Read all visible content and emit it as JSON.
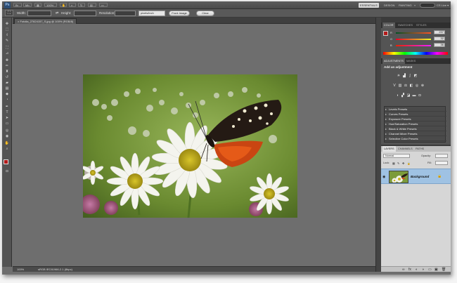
{
  "app": {
    "logo": "Ps",
    "zoom": "100%",
    "view_menu": "▾"
  },
  "workspace": {
    "items": [
      "ESSENTIALS",
      "DESIGN",
      "PAINTING",
      "»"
    ],
    "active": "ESSENTIALS",
    "cs_live": "CS Live ▾"
  },
  "options_bar": {
    "width_label": "Width:",
    "height_label": "Height:",
    "resolution_label": "Resolution:",
    "units_value": "pixels/inch",
    "front_image_label": "Front Image",
    "clear_label": "Clear",
    "swap_icon": "⇄"
  },
  "document": {
    "tab_title": "Fotolia_27824157_S.jpg @ 100% (RGB/8)",
    "tab_close": "×",
    "status_zoom": "100%",
    "status_profile": "sRGB IEC61966-2.1 (8bpc)"
  },
  "color_panel": {
    "tabs": [
      "COLOR",
      "SWATCHES",
      "STYLES"
    ],
    "active_tab": "COLOR",
    "channels": [
      {
        "name": "R",
        "value": "237",
        "gradient": "linear-gradient(90deg,#005224,#ff5224)"
      },
      {
        "name": "G",
        "value": "32",
        "gradient": "linear-gradient(90deg,#ed0024,#edff24)"
      },
      {
        "name": "B",
        "value": "36",
        "gradient": "linear-gradient(90deg,#ed2000,#ed20ff)"
      }
    ],
    "foreground": "#b31b1b"
  },
  "adjustments_panel": {
    "tabs": [
      "ADJUSTMENTS",
      "MASKS"
    ],
    "active_tab": "ADJUSTMENTS",
    "title": "Add an adjustment",
    "presets": [
      "Levels Presets",
      "Curves Presets",
      "Exposure Presets",
      "Hue/Saturation Presets",
      "Black & White Presets",
      "Channel Mixer Presets",
      "Selective Color Presets"
    ]
  },
  "layers_panel": {
    "tabs": [
      "LAYERS",
      "CHANNELS",
      "PATHS"
    ],
    "active_tab": "LAYERS",
    "blend_mode": "Normal",
    "opacity_label": "Opacity:",
    "lock_label": "Lock:",
    "fill_label": "Fill:",
    "layer_name": "Background",
    "eye_icon": "◉",
    "lock_icon": "🔒",
    "footer_icons": [
      "∞",
      "fx",
      "◐",
      "◑",
      "▭",
      "▣",
      "🗑"
    ]
  }
}
